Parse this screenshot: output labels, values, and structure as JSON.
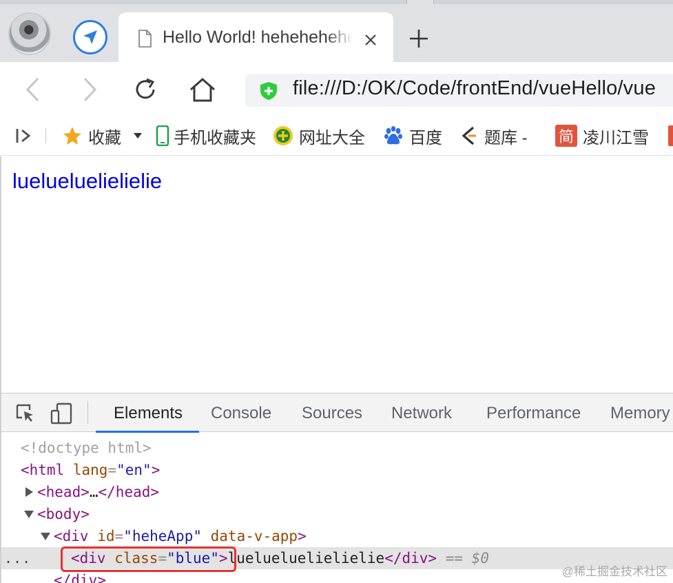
{
  "browser": {
    "tab": {
      "title": "Hello World! hehehehehe",
      "close": "×"
    },
    "new_tab": "+",
    "address": {
      "url": "file:///D:/OK/Code/frontEnd/vueHello/vue"
    }
  },
  "bookmarks": {
    "items": [
      {
        "label": "收藏",
        "icon": "star-icon"
      },
      {
        "label": "手机收藏夹",
        "icon": "phone-icon"
      },
      {
        "label": "网址大全",
        "icon": "plus-circle-icon"
      },
      {
        "label": "百度",
        "icon": "paw-icon"
      },
      {
        "label": "题库 -",
        "icon": "bookmark-logo-icon"
      },
      {
        "label": "凌川江雪",
        "icon": "jian-icon",
        "icon_text": "简"
      }
    ]
  },
  "page": {
    "text": "luelueluelielielie"
  },
  "devtools": {
    "tabs": [
      "Elements",
      "Console",
      "Sources",
      "Network",
      "Performance",
      "Memory"
    ],
    "active_tab": "Elements",
    "dom": {
      "doctype": "<!doctype html>",
      "html_open": "<html",
      "html_attr": "lang",
      "html_val": "\"en\"",
      "head_open": "<head>",
      "head_ellipsis": "…",
      "head_close": "</head>",
      "body_open": "<body>",
      "app_div_open": "<div",
      "app_id_attr": "id",
      "app_id_val": "\"heheApp\"",
      "app_v_attr": "data-v-app",
      "blue_div_open": "<div",
      "blue_class_attr": "class",
      "blue_class_val": "\"blue\"",
      "blue_text": "luelueluelielielie",
      "blue_div_close": "</div>",
      "selected_ref": "$0",
      "selected_eq": "==",
      "last_close": "</div>",
      "row_dots": "..."
    }
  },
  "watermark": "@稀土掘金技术社区",
  "colors": {
    "link_blue": "#0000dd",
    "highlight": "#e8302d",
    "devtools_accent": "#1a73e8"
  }
}
